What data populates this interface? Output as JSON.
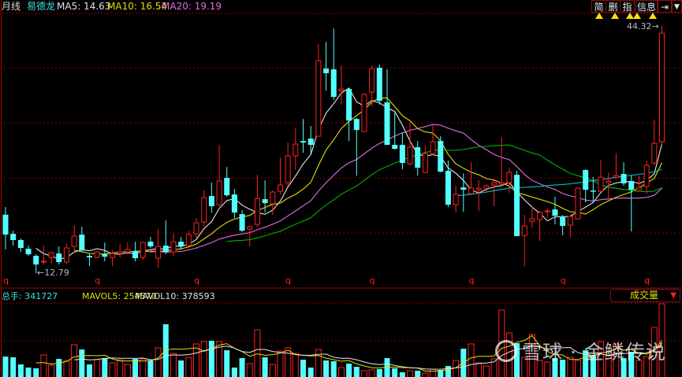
{
  "header": {
    "period": "月线",
    "stock_name": "易德龙",
    "ma5": "MA5: 14.63",
    "ma10": "MA10: 16.54",
    "ma20": "MA20: 19.19"
  },
  "toolbar": {
    "simple": "简",
    "delete": "删",
    "indicator": "指",
    "info": "信息",
    "expand_icon": "arrow-to-right-icon",
    "dropdown_icon": "chevron-down-icon"
  },
  "volume_header": {
    "total": "总手: 341727",
    "mavol5": "MAVOL5: 254570",
    "mavol10": "MAVOL10: 378593",
    "selector": "成交量",
    "selector_arrow": "▼"
  },
  "labels": {
    "high": "44.32",
    "low": "12.79"
  },
  "watermark": "雪球 · 金鳞传说",
  "colors": {
    "up": "#ff2020",
    "down": "#54ffff",
    "ma5": "#e6e6e6",
    "ma10": "#e0e000",
    "ma20": "#e070e0",
    "ma30": "#00b400",
    "ma60": "#00c0c8",
    "grid": "#8a0000"
  },
  "chart_data": {
    "type": "candlestick",
    "period": "monthly",
    "ylim": [
      12.79,
      44.32
    ],
    "ma_periods": [
      5,
      10,
      20,
      30,
      60
    ],
    "year_marker": "q",
    "year_marker_indices": [
      0,
      12,
      25,
      37,
      48,
      61,
      73,
      84
    ],
    "ohlc": [
      [
        20.27,
        21.25,
        15.81,
        17.72
      ],
      [
        17.82,
        18.22,
        16.31,
        17.02
      ],
      [
        17.02,
        17.22,
        15.51,
        16.01
      ],
      [
        15.91,
        16.31,
        15.0,
        15.2
      ],
      [
        15.0,
        15.2,
        12.79,
        13.89
      ],
      [
        14.2,
        16.31,
        13.89,
        14.3
      ],
      [
        14.8,
        15.51,
        13.99,
        15.41
      ],
      [
        15.3,
        16.21,
        13.89,
        14.2
      ],
      [
        14.2,
        16.61,
        13.99,
        16.01
      ],
      [
        16.21,
        18.93,
        15.81,
        17.52
      ],
      [
        17.72,
        18.73,
        15.51,
        15.71
      ],
      [
        15.0,
        15.3,
        13.69,
        14.8
      ],
      [
        14.8,
        15.61,
        14.7,
        15.51
      ],
      [
        15.2,
        16.71,
        14.3,
        14.9
      ],
      [
        14.8,
        15.71,
        13.69,
        15.3
      ],
      [
        15.3,
        16.51,
        14.8,
        15.51
      ],
      [
        15.51,
        16.71,
        15.2,
        15.81
      ],
      [
        15.61,
        16.81,
        14.3,
        14.7
      ],
      [
        14.8,
        16.81,
        14.5,
        16.71
      ],
      [
        16.81,
        17.42,
        16.01,
        16.21
      ],
      [
        14.7,
        18.43,
        13.49,
        16.21
      ],
      [
        16.31,
        19.53,
        15.2,
        15.51
      ],
      [
        15.51,
        17.92,
        15.0,
        16.81
      ],
      [
        16.81,
        17.42,
        15.81,
        16.21
      ],
      [
        16.31,
        18.22,
        16.21,
        17.72
      ],
      [
        17.82,
        19.84,
        17.22,
        19.23
      ],
      [
        19.33,
        23.36,
        18.73,
        22.45
      ],
      [
        22.66,
        24.37,
        20.54,
        21.35
      ],
      [
        21.55,
        29.2,
        21.25,
        24.57
      ],
      [
        24.97,
        26.38,
        22.56,
        22.76
      ],
      [
        22.86,
        23.56,
        19.84,
        20.54
      ],
      [
        20.34,
        20.84,
        18.02,
        18.22
      ],
      [
        18.43,
        18.83,
        16.21,
        18.73
      ],
      [
        19.03,
        25.37,
        18.73,
        22.35
      ],
      [
        22.25,
        24.67,
        20.54,
        21.75
      ],
      [
        21.65,
        23.36,
        20.24,
        23.16
      ],
      [
        23.26,
        27.59,
        22.86,
        24.07
      ],
      [
        24.37,
        29.5,
        23.87,
        27.79
      ],
      [
        27.79,
        31.32,
        25.98,
        29.3
      ],
      [
        29.7,
        32.52,
        28.19,
        29.5
      ],
      [
        30.01,
        31.62,
        28.09,
        29.2
      ],
      [
        30.31,
        42.09,
        30.31,
        39.98
      ],
      [
        38.97,
        42.39,
        36.15,
        38.37
      ],
      [
        38.87,
        44.1,
        34.94,
        35.34
      ],
      [
        36.15,
        39.37,
        34.34,
        36.35
      ],
      [
        36.35,
        36.45,
        29.7,
        32.32
      ],
      [
        32.52,
        32.62,
        25.27,
        31.11
      ],
      [
        30.91,
        35.85,
        30.81,
        35.65
      ],
      [
        35.95,
        39.37,
        34.14,
        38.97
      ],
      [
        39.07,
        39.47,
        34.34,
        34.84
      ],
      [
        34.64,
        38.87,
        29.2,
        29.2
      ],
      [
        29.2,
        33.33,
        28.6,
        28.7
      ],
      [
        29.2,
        30.81,
        26.08,
        26.89
      ],
      [
        26.78,
        32.12,
        26.58,
        28.9
      ],
      [
        28.9,
        29.7,
        25.27,
        26.28
      ],
      [
        25.68,
        29.1,
        25.58,
        28.09
      ],
      [
        28.09,
        31.72,
        27.89,
        29.6
      ],
      [
        29.7,
        30.31,
        25.68,
        25.78
      ],
      [
        25.88,
        27.19,
        21.25,
        21.55
      ],
      [
        21.55,
        23.97,
        20.54,
        22.86
      ],
      [
        23.76,
        25.58,
        20.64,
        23.46
      ],
      [
        22.96,
        26.99,
        22.86,
        23.66
      ],
      [
        23.46,
        24.67,
        20.74,
        23.66
      ],
      [
        23.66,
        24.17,
        23.26,
        23.97
      ],
      [
        24.07,
        24.87,
        21.35,
        24.37
      ],
      [
        24.17,
        30.21,
        24.07,
        24.37
      ],
      [
        24.37,
        26.28,
        23.06,
        25.68
      ],
      [
        25.37,
        25.88,
        17.52,
        17.52
      ],
      [
        17.62,
        20.24,
        13.69,
        18.83
      ],
      [
        19.43,
        21.25,
        18.63,
        19.74
      ],
      [
        19.64,
        20.74,
        16.92,
        20.54
      ],
      [
        20.64,
        21.05,
        19.84,
        20.74
      ],
      [
        20.94,
        22.56,
        19.03,
        20.14
      ],
      [
        20.04,
        20.24,
        17.62,
        18.83
      ],
      [
        18.93,
        20.24,
        17.42,
        20.04
      ],
      [
        19.74,
        23.76,
        19.64,
        23.66
      ],
      [
        25.98,
        26.08,
        21.85,
        23.46
      ],
      [
        23.36,
        25.07,
        21.85,
        23.26
      ],
      [
        23.26,
        27.29,
        23.26,
        25.07
      ],
      [
        24.37,
        25.68,
        22.25,
        24.57
      ],
      [
        25.07,
        28.09,
        24.77,
        25.27
      ],
      [
        25.48,
        26.99,
        23.97,
        24.27
      ],
      [
        24.57,
        25.27,
        18.12,
        23.46
      ],
      [
        23.46,
        25.27,
        23.36,
        23.76
      ],
      [
        23.87,
        27.19,
        22.96,
        26.58
      ],
      [
        26.89,
        32.42,
        26.58,
        29.4
      ],
      [
        29.6,
        44.41,
        29.22,
        43.5
      ]
    ],
    "volume": [
      95550,
      91875,
      58800,
      44100,
      40425,
      102900,
      55125,
      84525,
      77175,
      150675,
      128625,
      58800,
      80850,
      88200,
      66150,
      80850,
      58800,
      84525,
      84525,
      77175,
      135975,
      246225,
      110250,
      77175,
      91875,
      154350,
      165375,
      169050,
      165375,
      124950,
      44100,
      88200,
      62475,
      220500,
      91875,
      58800,
      121275,
      135975,
      110250,
      80850,
      44100,
      128625,
      77175,
      73500,
      44100,
      62475,
      47775,
      29400,
      33075,
      36750,
      88200,
      40425,
      22050,
      29400,
      29400,
      18375,
      36750,
      33075,
      51450,
      77175,
      132300,
      154350,
      66150,
      51450,
      84525,
      312375,
      205800,
      158025,
      91875,
      198450,
      77175,
      69825,
      88200,
      80850,
      91875,
      77175,
      124950,
      102900,
      165375,
      117600,
      154350,
      88200,
      117600,
      77175,
      95550,
      231525,
      341727
    ],
    "mavol_periods": [
      5,
      10
    ]
  }
}
